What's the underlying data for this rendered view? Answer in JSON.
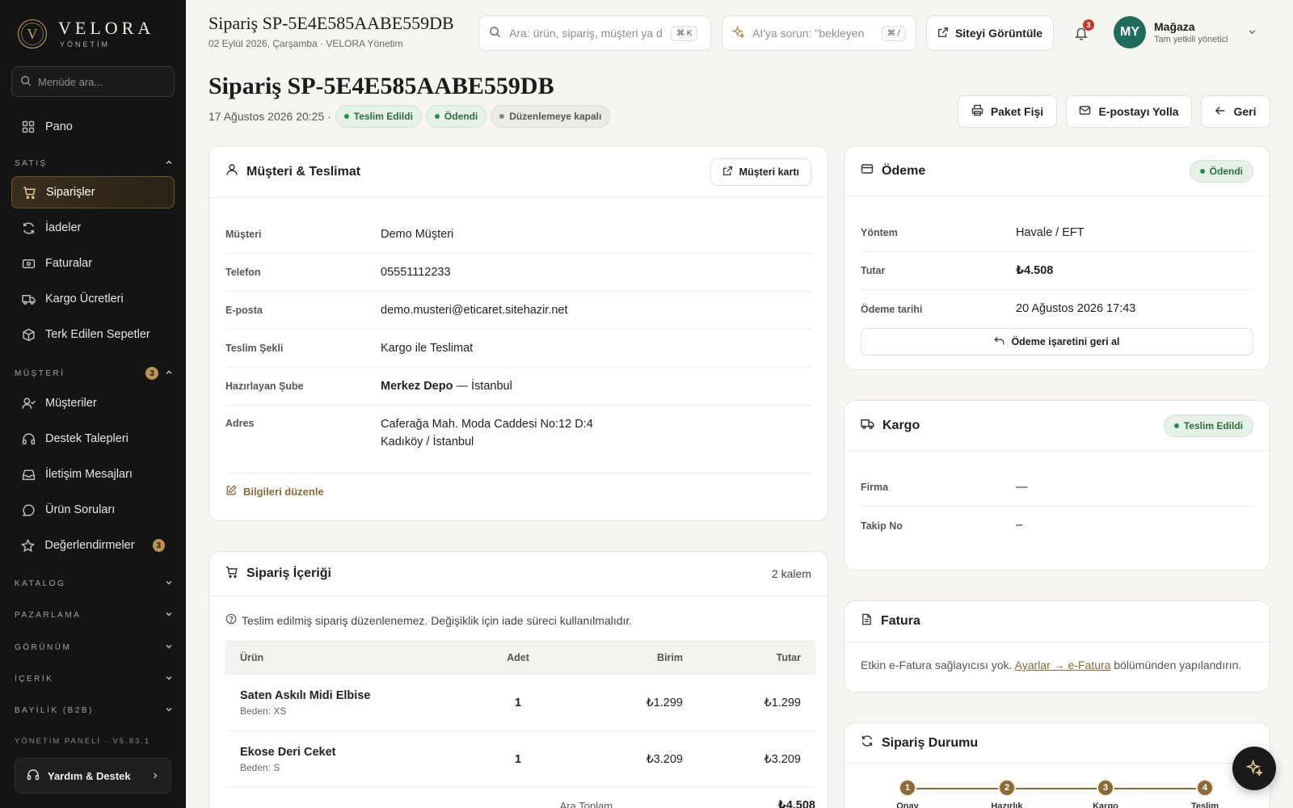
{
  "brand": {
    "name": "VELORA",
    "sub": "YÖNETİM",
    "logo_letter": "V"
  },
  "sidebar": {
    "search_placeholder": "Menüde ara...",
    "pano": "Pano",
    "sections": {
      "satis": "SATIŞ",
      "musteri": "MÜŞTERİ",
      "musteri_badge": "3",
      "katalog": "KATALOG",
      "pazarlama": "PAZARLAMA",
      "gorunum": "GÖRÜNÜM",
      "icerik": "İÇERİK",
      "bayilik": "BAYİLİK (B2B)"
    },
    "satis_items": [
      "Siparişler",
      "İadeler",
      "Faturalar",
      "Kargo Ücretleri",
      "Terk Edilen Sepetler"
    ],
    "musteri_items": [
      "Müşteriler",
      "Destek Talepleri",
      "İletişim Mesajları",
      "Ürün Soruları",
      "Değerlendirmeler"
    ],
    "degerlendirme_badge": "3",
    "version": "YÖNETİM PANELİ · V5.83.1",
    "help": "Yardım & Destek"
  },
  "topbar": {
    "title": "Sipariş SP-5E4E585AABE559DB",
    "subtitle": "02 Eylül 2026, Çarşamba · VELORA Yönetim",
    "search_placeholder": "Ara: ürün, sipariş, müşteri ya da",
    "search_kbd": "⌘ K",
    "ai_placeholder": "AI'ya sorun: \"bekleyen",
    "ai_kbd": "⌘ /",
    "site_button": "Siteyi Görüntüle",
    "notif_count": "3",
    "user_initials": "MY",
    "user_name": "Mağaza",
    "user_role": "Tam yetkili yönetici"
  },
  "page": {
    "title": "Sipariş SP-5E4E585AABE559DB",
    "datetime": "17 Ağustos 2026 20:25 ·",
    "chips": [
      "Teslim Edildi",
      "Ödendi",
      "Düzenlemeye kapalı"
    ],
    "buttons": {
      "print": "Paket Fişi",
      "email": "E-postayı Yolla",
      "back": "Geri"
    }
  },
  "customer_card": {
    "title": "Müşteri & Teslimat",
    "card_button": "Müşteri kartı",
    "rows": [
      {
        "label": "Müşteri",
        "value": "Demo Müşteri"
      },
      {
        "label": "Telefon",
        "value": "05551112233"
      },
      {
        "label": "E-posta",
        "value": "demo.musteri@eticaret.sitehazir.net"
      },
      {
        "label": "Teslim Şekli",
        "value": "Kargo ile Teslimat"
      }
    ],
    "branch_label": "Hazırlayan Şube",
    "branch_name": "Merkez Depo",
    "branch_city": " — İstanbul",
    "address_label": "Adres",
    "address_line1": "Caferağa Mah. Moda Caddesi No:12 D:4",
    "address_line2": "Kadıköy / İstanbul",
    "edit": "Bilgileri düzenle"
  },
  "items_card": {
    "title": "Sipariş İçeriği",
    "count": "2 kalem",
    "notice": "Teslim edilmiş sipariş düzenlenemez. Değişiklik için iade süreci kullanılmalıdır.",
    "headers": {
      "product": "Ürün",
      "qty": "Adet",
      "unit": "Birim",
      "total": "Tutar"
    },
    "rows": [
      {
        "name": "Saten Askılı Midi Elbise",
        "variant": "Beden: XS",
        "qty": "1",
        "unit": "₺1.299",
        "total": "₺1.299"
      },
      {
        "name": "Ekose Deri Ceket",
        "variant": "Beden: S",
        "qty": "1",
        "unit": "₺3.209",
        "total": "₺3.209"
      }
    ],
    "subtotal_label": "Ara Toplam",
    "subtotal_value": "₺4.508"
  },
  "payment_card": {
    "title": "Ödeme",
    "status": "Ödendi",
    "rows": [
      {
        "label": "Yöntem",
        "value": "Havale / EFT"
      },
      {
        "label": "Tutar",
        "value": "₺4.508"
      },
      {
        "label": "Ödeme tarihi",
        "value": "20 Ağustos 2026 17:43"
      }
    ],
    "undo": "Ödeme işaretini geri al"
  },
  "cargo_card": {
    "title": "Kargo",
    "status": "Teslim Edildi",
    "rows": [
      {
        "label": "Firma",
        "value": "—"
      },
      {
        "label": "Takip No",
        "value": "–"
      }
    ]
  },
  "invoice_card": {
    "title": "Fatura",
    "text_before": "Etkin e-Fatura sağlayıcısı yok. ",
    "link": "Ayarlar → e-Fatura",
    "text_after": " bölümünden yapılandırın."
  },
  "status_card": {
    "title": "Sipariş Durumu",
    "steps": [
      "1",
      "2",
      "3",
      "4"
    ],
    "step_labels": [
      "Onay",
      "Hazırlık",
      "Kargo",
      "Teslim"
    ]
  },
  "colors": {
    "accent": "#8a6a3a",
    "sidebar": "#141414",
    "success": "#2f8a4b",
    "avatar": "#1f6b5c"
  }
}
